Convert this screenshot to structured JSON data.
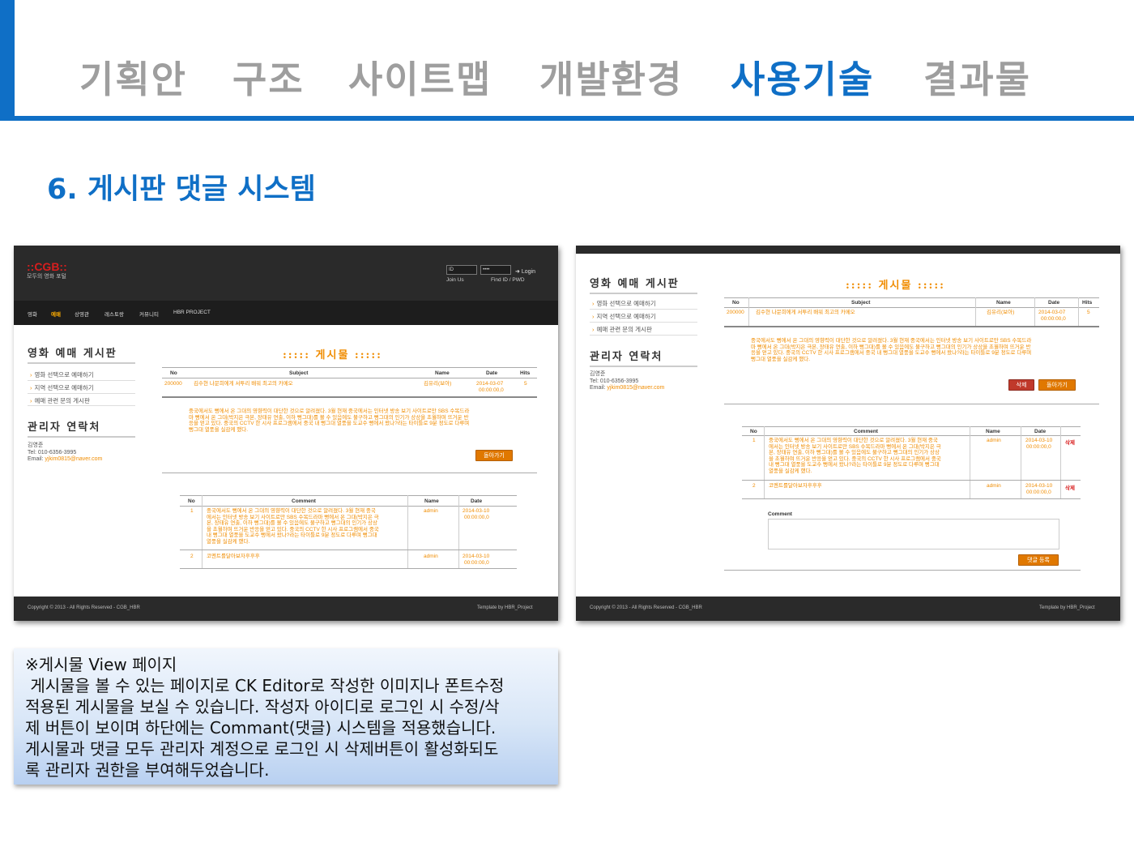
{
  "header": {
    "tabs": [
      {
        "label": "기획안",
        "active": false
      },
      {
        "label": "구조",
        "active": false
      },
      {
        "label": "사이트맵",
        "active": false
      },
      {
        "label": "개발환경",
        "active": false
      },
      {
        "label": "사용기술",
        "active": true
      },
      {
        "label": "결과물",
        "active": false
      }
    ],
    "accent_color": "#0f6fc6"
  },
  "section_title": "6. 게시판 댓글 시스템",
  "site": {
    "logo": "::CGB::",
    "tagline": "모두의 영화 포털",
    "id_placeholder": "ID",
    "pw_value": "••••",
    "login_label": "Login",
    "join_us": "Join Us",
    "find_id": "Find ID / PWD",
    "menu": [
      "영화",
      "예매",
      "상영관",
      "레스토랑",
      "커뮤니티",
      "HBR PROJECT"
    ],
    "sidebar_title": "영화 예매 게시판",
    "sidebar_items": [
      "영화 선택으로 예매하기",
      "지역 선택으로 예매하기",
      "예매 관련 문의 게시판"
    ],
    "contact_title": "관리자 연락처",
    "contact_name": "김영준",
    "contact_tel": "Tel: 010-6356-3995",
    "contact_email_label": "Email:",
    "contact_email": "yjkim0815@naver.com",
    "board_title": ":::::  게시물  :::::",
    "table_headers": {
      "no": "No",
      "subject": "Subject",
      "name": "Name",
      "date": "Date",
      "hits": "Hits"
    },
    "post": {
      "no": "200000",
      "subject": "김수현 나문희에게 서투리 배워 최고의 카메오",
      "name": "김유리(보아)",
      "date1": "2014-03-07",
      "date2": "00:00:00,0",
      "hits": "5"
    },
    "post_body": [
      "중국에서도 뻥에서 온 그대의 영향력이 대단한 것으로 알려졌다. 3월 현재 중국에서는 인터넷 방송 보기 사이트로만 SBS 수목드라",
      "마 뻥에서 온 그대(박지은 극본, 장태유 연출, 이하 뻥그대)를 볼 수 있음에도 불구하고 뻥그대의 인기가 상상을 초월하며 뜨거운 반",
      "응을 얻고 있다. 중국의 CCTV 한 시사 프로그램에서 중국 내 뻥그대 열풍을 도교수 뻥에서 왔나?라는 타이틀로 9분 정도로 다루며",
      "뻥그대 열풍을 실감케 했다."
    ],
    "post_body_narrow": [
      "중국에서도 뻥에서 온 그대의 영향력이 대단한 것으로 알려졌다. 3월 현재 중국에서는 인터넷 방송 보기 사이트로만 SBS 수목드라",
      "마 뻥에서 온 그대(박지은 극본, 장태유 연출, 이하 뻥그대)를 볼 수 있음에도 불구하고 뻥그대의 인기가 상상을 초월하며 뜨거운 반",
      "응을 얻고 있다. 중국의 CCTV 한 시사 프로그램에서 중국 내 뻥그대 열풍을 도교수 뻥에서 왔나?라는 타이틀로 9분 정도로 다루며",
      "뻥그대 열풍을 실감케 했다."
    ],
    "back_button": "돌아가기",
    "delete_button": "삭제",
    "comment_headers": {
      "no": "No",
      "comment": "Comment",
      "name": "Name",
      "date": "Date"
    },
    "comments": [
      {
        "no": "1",
        "lines": [
          "중국에서도 뻥에서 온 그대의 영향력이 대단한 것으로 알려졌다. 3월 현재 중국",
          "에서는 인터넷 방송 보기 사이트로만 SBS 수목드라마 뻥에서 온 그대(박지은 극",
          "본, 장태유 연출, 이하 뻥그대)를 볼 수 있음에도 불구하고 뻥그대의 인기가 상상",
          "을 초월하며 뜨거운 반응을 얻고 있다. 중국의 CCTV 한 시사 프로그램에서 중국",
          "내 뻥그대 열풍을 도교수 뻥에서 왔나?라는 타이틀로 9분 정도로 다루며 뻥그대",
          "열풍을 실감케 했다."
        ],
        "name": "admin",
        "date1": "2014-03-10",
        "date2": "00:00:00,0"
      },
      {
        "no": "2",
        "lines": [
          "코멘트를달아보자후후후"
        ],
        "name": "admin",
        "date1": "2014-03-10",
        "date2": "00:00:00,0"
      }
    ],
    "comment_delete": "삭제",
    "comment_input_label": "Comment",
    "comment_submit": "댓글 등록",
    "footer_left": "Copyright © 2013 - All Rights Reserved - CGB_HBR",
    "footer_right": "Template by HBR_Project"
  },
  "note": {
    "lines": [
      "※게시물 View 페이지",
      " 게시물을 볼 수 있는 페이지로 CK Editor로 작성한 이미지나 폰트수정",
      "적용된 게시물을 보실 수 있습니다. 작성자 아이디로 로그인 시 수정/삭",
      "제 버튼이 보이며 하단에는 Commant(댓글) 시스템을 적용했습니다.",
      "게시물과 댓글 모두 관리자 계정으로 로그인 시 삭제버튼이 활성화되도",
      "록 관리자 권한을 부여해두었습니다."
    ]
  }
}
